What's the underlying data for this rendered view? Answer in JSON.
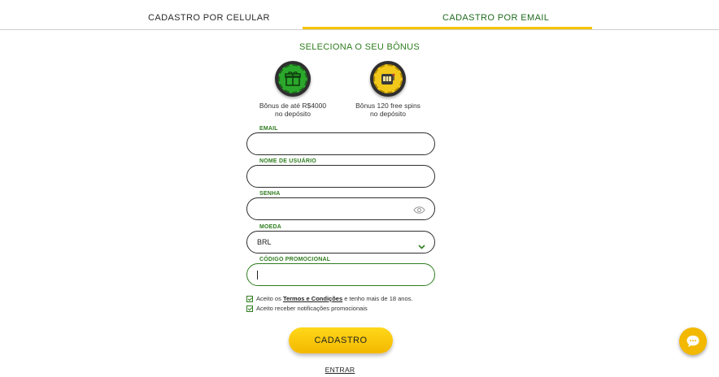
{
  "tabs": {
    "phone": "CADASTRO POR CELULAR",
    "email": "CADASTRO POR EMAIL"
  },
  "bonus": {
    "title": "SELECIONA O SEU BÔNUS",
    "options": [
      {
        "line1": "Bônus de até R$4000",
        "line2": "no depósito",
        "icon": "gift-icon",
        "color": "#2ba82b"
      },
      {
        "line1": "Bônus 120 free spins",
        "line2": "no depósito",
        "icon": "slot-machine-icon",
        "color": "#f2c81a"
      }
    ]
  },
  "form": {
    "email_label": "EMAIL",
    "email_value": "",
    "username_label": "NOME DE USUÁRIO",
    "username_value": "",
    "password_label": "SENHA",
    "password_value": "",
    "currency_label": "MOEDA",
    "currency_value": "BRL",
    "promo_label": "CÓDIGO PROMOCIONAL",
    "promo_value": ""
  },
  "checks": {
    "terms_prefix": "Aceito os ",
    "terms_link": "Termos e Condições",
    "terms_suffix": " e tenho mais de 18 anos.",
    "notifications": "Aceito receber notificações promocionais"
  },
  "actions": {
    "submit": "CADASTRO",
    "login": "ENTRAR"
  },
  "colors": {
    "accent_green": "#2f7d1f",
    "accent_yellow": "#f5c400"
  }
}
